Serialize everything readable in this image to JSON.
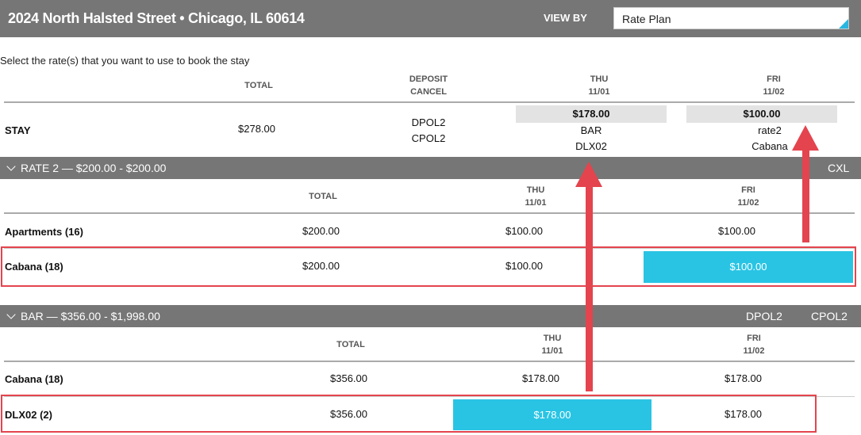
{
  "header": {
    "address": "2024 North Halsted Street • Chicago, IL 60614",
    "view_by_label": "VIEW BY",
    "view_by_value": "Rate Plan"
  },
  "instruction": "Select the rate(s) that you want to use to book the stay",
  "stay": {
    "headers": {
      "total": "TOTAL",
      "deposit": "DEPOSIT",
      "cancel": "CANCEL",
      "thu": "THU",
      "thu_date": "11/01",
      "fri": "FRI",
      "fri_date": "11/02"
    },
    "label": "STAY",
    "total": "$278.00",
    "deposit_policy": "DPOL2",
    "cancel_policy": "CPOL2",
    "thu": {
      "price": "$178.00",
      "plan": "BAR",
      "room": "DLX02"
    },
    "fri": {
      "price": "$100.00",
      "plan": "rate2",
      "room": "Cabana"
    }
  },
  "rate2": {
    "title": "RATE 2 — $200.00 - $200.00",
    "right1": "CXL",
    "headers": {
      "total": "TOTAL",
      "thu": "THU",
      "thu_date": "11/01",
      "fri": "FRI",
      "fri_date": "11/02"
    },
    "rows": [
      {
        "name": "Apartments (16)",
        "total": "$200.00",
        "thu": "$100.00",
        "fri": "$100.00"
      },
      {
        "name": "Cabana (18)",
        "total": "$200.00",
        "thu": "$100.00",
        "fri": "$100.00"
      }
    ]
  },
  "bar": {
    "title": "BAR — $356.00 - $1,998.00",
    "right1": "DPOL2",
    "right2": "CPOL2",
    "headers": {
      "total": "TOTAL",
      "thu": "THU",
      "thu_date": "11/01",
      "fri": "FRI",
      "fri_date": "11/02"
    },
    "rows": [
      {
        "name": "Cabana (18)",
        "total": "$356.00",
        "thu": "$178.00",
        "fri": "$178.00"
      },
      {
        "name": "DLX02 (2)",
        "total": "$356.00",
        "thu": "$178.00",
        "fri": "$178.00"
      }
    ]
  },
  "colors": {
    "accent": "#29c4e4",
    "annotation": "#e4444e",
    "band": "#767676"
  }
}
